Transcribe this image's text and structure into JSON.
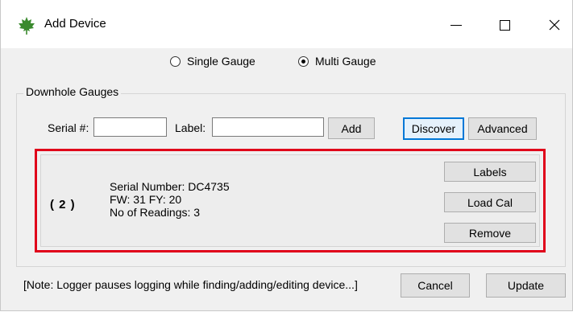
{
  "window": {
    "title": "Add Device",
    "icon": "maple-leaf-icon",
    "icon_color": "#3a8a2e"
  },
  "mode": {
    "options": [
      {
        "label": "Single Gauge",
        "checked": false
      },
      {
        "label": "Multi Gauge",
        "checked": true
      }
    ]
  },
  "group": {
    "title": "Downhole Gauges",
    "serial_label": "Serial #:",
    "serial_value": "",
    "label_label": "Label:",
    "label_value": "",
    "add_button": "Add",
    "discover_button": "Discover",
    "advanced_button": "Advanced"
  },
  "gauge": {
    "index": "( 2 )",
    "serial_line": "Serial Number: DC4735",
    "fw_line": "FW: 31 FY: 20",
    "readings_line": "No of Readings: 3",
    "labels_button": "Labels",
    "loadcal_button": "Load Cal",
    "remove_button": "Remove",
    "highlight_color": "#e0001a"
  },
  "footer": {
    "note": "[Note: Logger pauses logging while finding/adding/editing device...]",
    "cancel_button": "Cancel",
    "update_button": "Update"
  }
}
